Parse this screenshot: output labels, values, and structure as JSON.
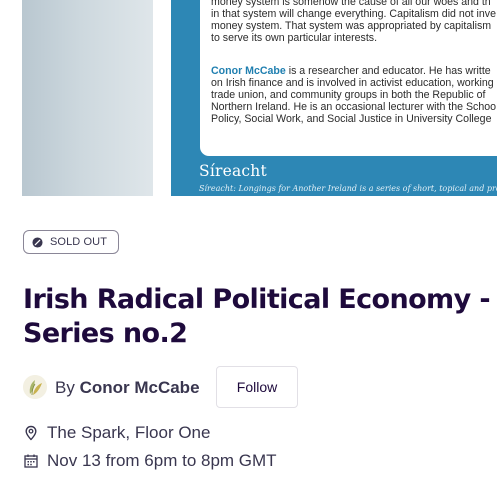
{
  "hero": {
    "card_paragraph_1": [
      "money system is somehow the cause of all our woes and th",
      "in that system will change everything. Capitalism did not inve",
      "money system. That system was appropriated by capitalism",
      "to serve its own particular interests."
    ],
    "card_author": "Conor McCabe",
    "card_paragraph_2_first": " is a researcher and educator. He has writte",
    "card_paragraph_2": [
      "on Irish finance and is involved in activist education, working",
      "trade union, and community groups in both the Republic of",
      "Northern Ireland. He is an occasional lecturer with the Schoo",
      "Policy, Social Work, and Social Justice in University College"
    ],
    "series_title": "Síreacht",
    "series_subtitle": "Síreacht: Longings for Another Ireland is a series of short, topical and provoca",
    "colors": {
      "banner_blue": "#2d87b5",
      "author_blue": "#1f7fb0"
    }
  },
  "status_badge": {
    "label": "SOLD OUT",
    "icon": "slash-circle-icon"
  },
  "event": {
    "title_line_1": "Irish Radical Political Economy - W",
    "title_line_2": "Series no.2",
    "title_color": "#1e0a3c"
  },
  "organizer": {
    "by_prefix": "By ",
    "name": "Conor McCabe",
    "avatar_icon": "leaf-avatar-icon",
    "follow_label": "Follow"
  },
  "location": {
    "icon": "map-pin-icon",
    "text": "The Spark, Floor One"
  },
  "datetime": {
    "icon": "calendar-icon",
    "text": "Nov 13 from 6pm to 8pm GMT"
  }
}
